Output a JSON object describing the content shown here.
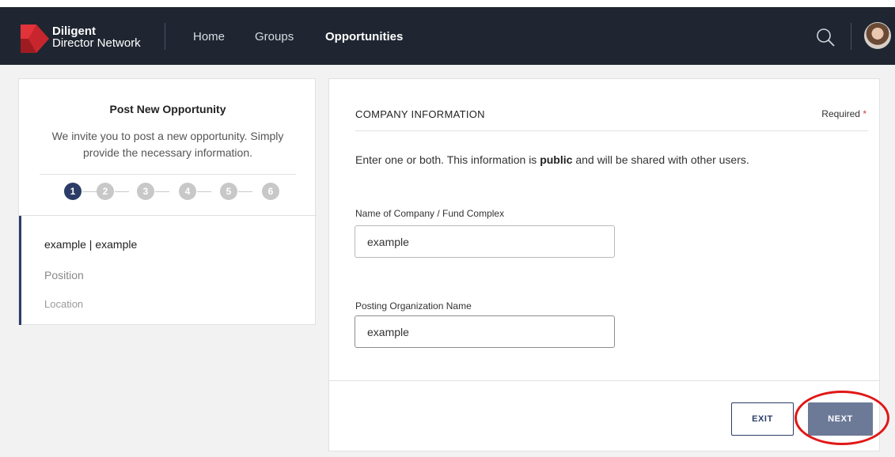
{
  "nav": {
    "brand_line1": "Diligent",
    "brand_line2": "Director Network",
    "items": [
      {
        "label": "Home",
        "active": false
      },
      {
        "label": "Groups",
        "active": false
      },
      {
        "label": "Opportunities",
        "active": true
      }
    ],
    "icons": [
      "search-icon",
      "user-avatar"
    ]
  },
  "sidebar": {
    "title": "Post New Opportunity",
    "description": "We invite you to post a new opportunity. Simply provide the necessary information.",
    "steps": [
      "1",
      "2",
      "3",
      "4",
      "5",
      "6"
    ],
    "current_step": "1",
    "items": [
      "example | example",
      "Position",
      "Location"
    ]
  },
  "form": {
    "section_title": "COMPANY INFORMATION",
    "required_label": "Required",
    "required_marker": "*",
    "instructions_pre": "Enter one or both. This information is ",
    "instructions_bold": "public",
    "instructions_post": " and will be shared with other users.",
    "company_label": "Name of Company / Fund Complex",
    "company_value": "example",
    "org_label": "Posting Organization Name",
    "org_value": "example"
  },
  "actions": {
    "exit_label": "EXIT",
    "next_label": "NEXT"
  },
  "colors": {
    "navbar": "#1f2631",
    "accent": "#2b3c66",
    "next_button": "#6c7a98",
    "annotation": "#e01818"
  }
}
